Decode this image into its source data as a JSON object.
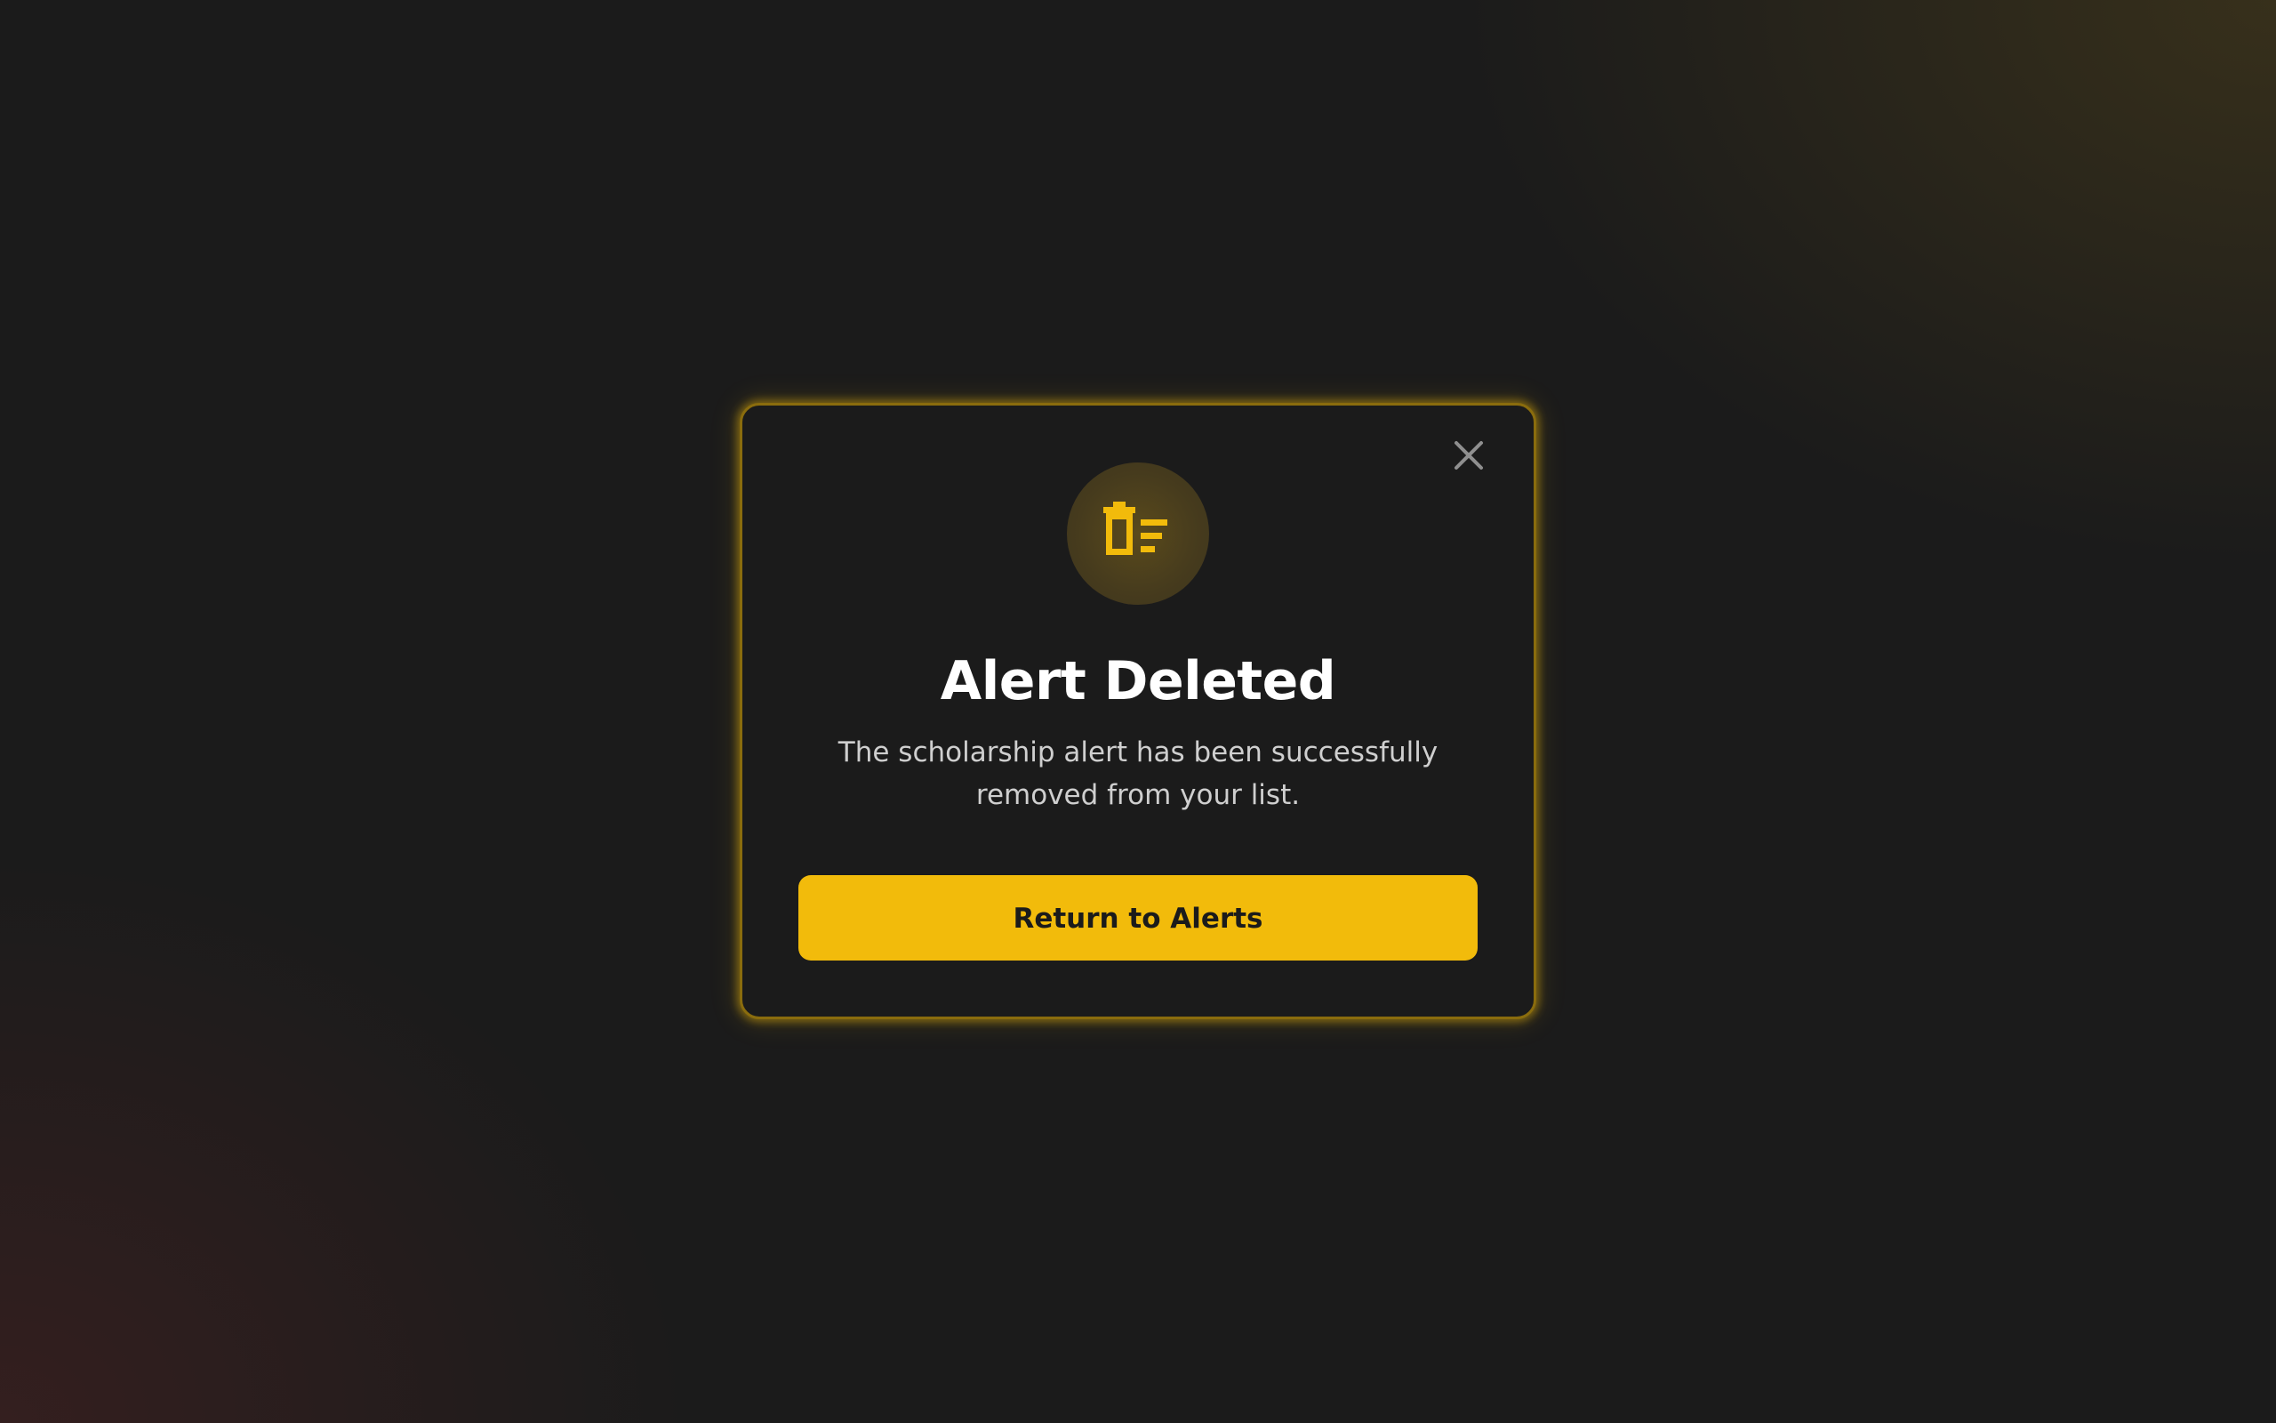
{
  "dialog": {
    "icon": "trash-list-icon",
    "title": "Alert Deleted",
    "message": "The scholarship alert has been successfully removed from your list.",
    "close_icon": "close-icon",
    "primary_button_label": "Return to Alerts"
  },
  "colors": {
    "accent": "#f2bb0b",
    "background": "#1b1b1b",
    "title_text": "#ffffff",
    "body_text": "#cfcfcf",
    "close_icon": "#8f8f8f",
    "icon_circle": "#463b1d"
  }
}
